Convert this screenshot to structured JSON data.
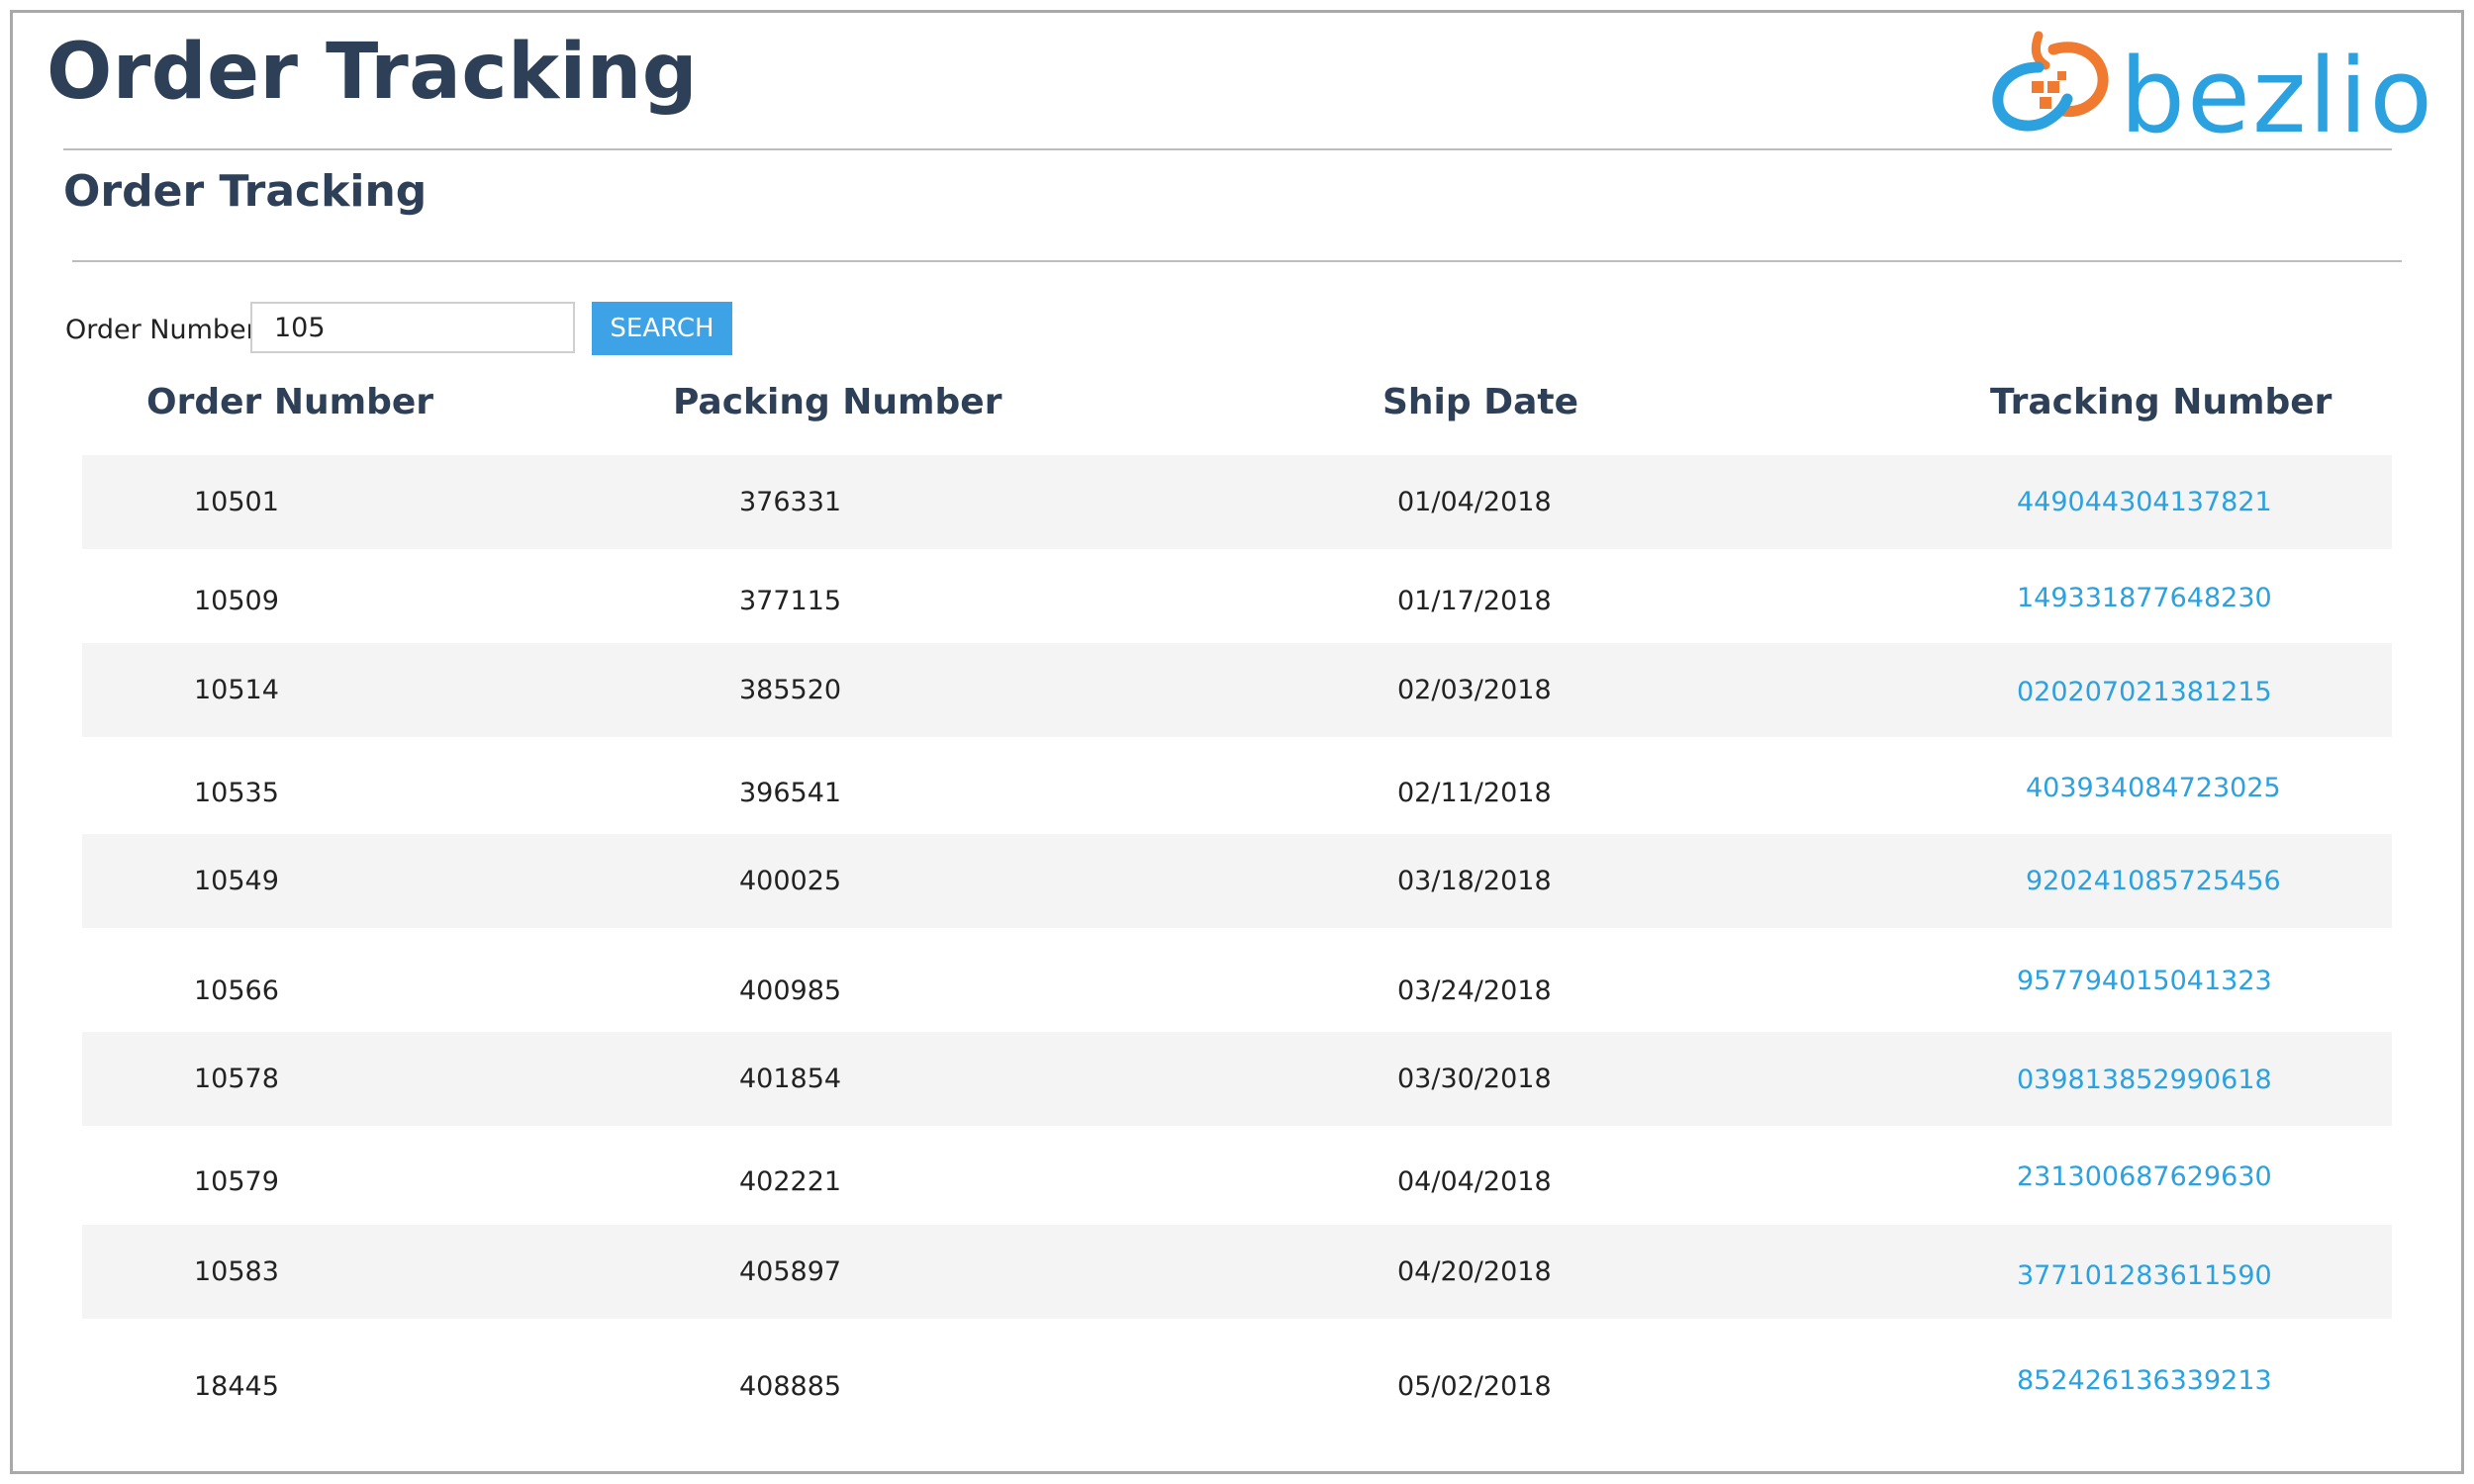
{
  "header": {
    "title": "Order Tracking",
    "logo_text": "bezlio"
  },
  "section": {
    "title": "Order Tracking"
  },
  "search": {
    "label": "Order Number",
    "value": "105",
    "button_label": "SEARCH"
  },
  "table": {
    "columns": [
      "Order Number",
      "Packing Number",
      "Ship Date",
      "Tracking Number"
    ],
    "rows": [
      {
        "order": "10501",
        "packing": "376331",
        "ship_date": "01/04/2018",
        "tracking": "449044304137821"
      },
      {
        "order": "10509",
        "packing": "377115",
        "ship_date": "01/17/2018",
        "tracking": "149331877648230"
      },
      {
        "order": "10514",
        "packing": "385520",
        "ship_date": "02/03/2018",
        "tracking": "020207021381215"
      },
      {
        "order": "10535",
        "packing": "396541",
        "ship_date": "02/11/2018",
        "tracking": "403934084723025"
      },
      {
        "order": "10549",
        "packing": "400025",
        "ship_date": "03/18/2018",
        "tracking": "920241085725456"
      },
      {
        "order": "10566",
        "packing": "400985",
        "ship_date": "03/24/2018",
        "tracking": "957794015041323"
      },
      {
        "order": "10578",
        "packing": "401854",
        "ship_date": "03/30/2018",
        "tracking": "039813852990618"
      },
      {
        "order": "10579",
        "packing": "402221",
        "ship_date": "04/04/2018",
        "tracking": "231300687629630"
      },
      {
        "order": "10583",
        "packing": "405897",
        "ship_date": "04/20/2018",
        "tracking": "377101283611590"
      },
      {
        "order": "18445",
        "packing": "408885",
        "ship_date": "05/02/2018",
        "tracking": "852426136339213"
      }
    ]
  },
  "colors": {
    "heading": "#2e4057",
    "link": "#2ba1e0",
    "button": "#3da2e6",
    "stripe": "#f4f4f4",
    "logo_orange": "#f07a30",
    "logo_blue": "#2ba1e0"
  },
  "icons": {
    "logo_mark": "bezlio-logo-mark-icon"
  }
}
